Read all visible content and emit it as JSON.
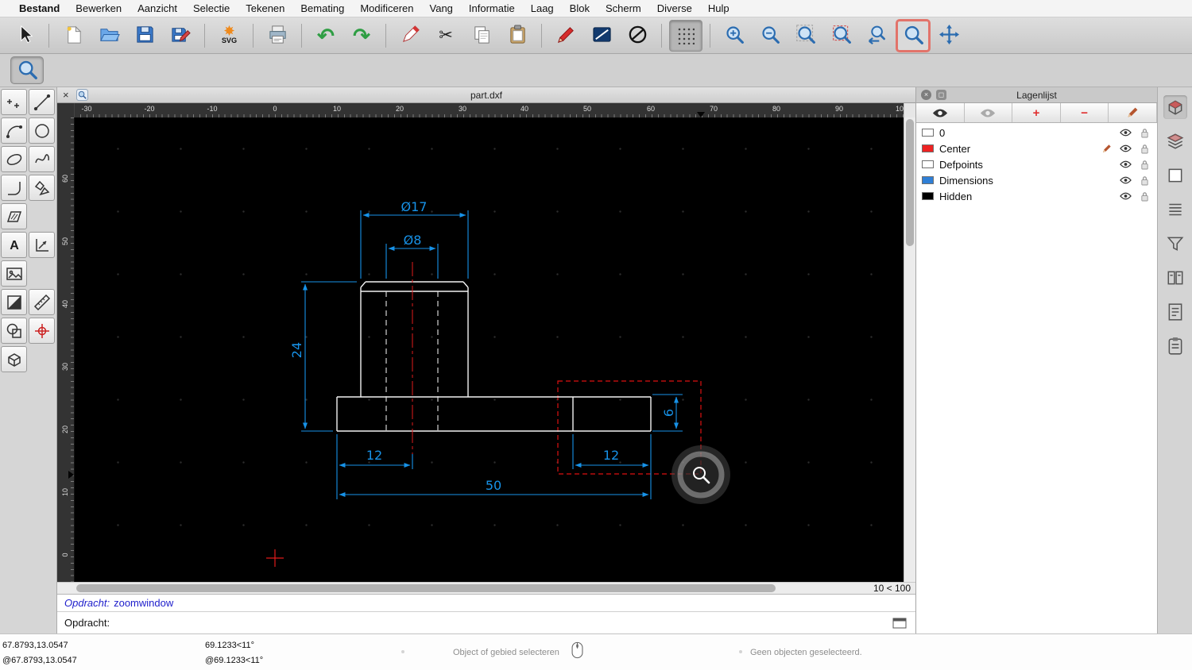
{
  "menu": {
    "items": [
      "Bestand",
      "Bewerken",
      "Aanzicht",
      "Selectie",
      "Tekenen",
      "Bemating",
      "Modificeren",
      "Vang",
      "Informatie",
      "Laag",
      "Blok",
      "Scherm",
      "Diverse",
      "Hulp"
    ]
  },
  "toolbar": {
    "svg_label": "SVG",
    "active_tool": "zoom-window",
    "icons": [
      "select",
      "new-document",
      "open-file",
      "save",
      "save-as",
      "svg-export",
      "print-preview",
      "undo",
      "redo",
      "eraser",
      "cut",
      "copy",
      "paste",
      "pen",
      "line-properties",
      "no-fill",
      "grid-toggle",
      "zoom-in",
      "zoom-out",
      "zoom-auto",
      "zoom-selection",
      "zoom-previous",
      "zoom-window",
      "pan"
    ]
  },
  "tool_options": {
    "active_tool_icon": "zoom-window"
  },
  "palette": {
    "text_tool_label": "A",
    "tools": [
      "points",
      "line",
      "arc",
      "circle",
      "ellipse",
      "spline",
      "polyline",
      "polygon",
      "hatch",
      "text",
      "dimension",
      "image",
      "solid-fill",
      "measure",
      "shape",
      "snap",
      "box-3d"
    ]
  },
  "document": {
    "title": "part.dxf",
    "zoom_indicator": "10 < 100",
    "ruler_h": [
      "-30",
      "-20",
      "-10",
      "0",
      "10",
      "20",
      "30",
      "40",
      "50",
      "60",
      "70",
      "80",
      "90",
      "10"
    ],
    "ruler_v": [
      "60",
      "50",
      "40",
      "30",
      "20",
      "10",
      "0"
    ],
    "dims": {
      "d17": "Ø17",
      "d8": "Ø8",
      "d24": "24",
      "d12a": "12",
      "d12b": "12",
      "d50": "50",
      "d6": "6"
    }
  },
  "panel": {
    "title": "Lagenlijst",
    "layers": [
      {
        "name": "0",
        "color": "#ffffff",
        "current": false
      },
      {
        "name": "Center",
        "color": "#ee2222",
        "current": true
      },
      {
        "name": "Defpoints",
        "color": "#ffffff",
        "current": false
      },
      {
        "name": "Dimensions",
        "color": "#2f7fd6",
        "current": false
      },
      {
        "name": "Hidden",
        "color": "#000000",
        "current": false
      }
    ]
  },
  "command": {
    "history_label": "Opdracht:",
    "history_value": "zoomwindow",
    "prompt_label": "Opdracht:",
    "input_value": ""
  },
  "statusbar": {
    "abs_coord": "67.8793,13.0547",
    "rel_coord": "@67.8793,13.0547",
    "abs_polar": "69.1233<11°",
    "rel_polar": "@69.1233<11°",
    "hint": "Object of gebied selecteren",
    "selection": "Geen objecten geselecteerd."
  },
  "colors": {
    "dimension_blue": "#1792e8",
    "centerline_red": "#e01b1b",
    "part_white": "#f2f2f2",
    "selection_red": "#dd1111"
  }
}
